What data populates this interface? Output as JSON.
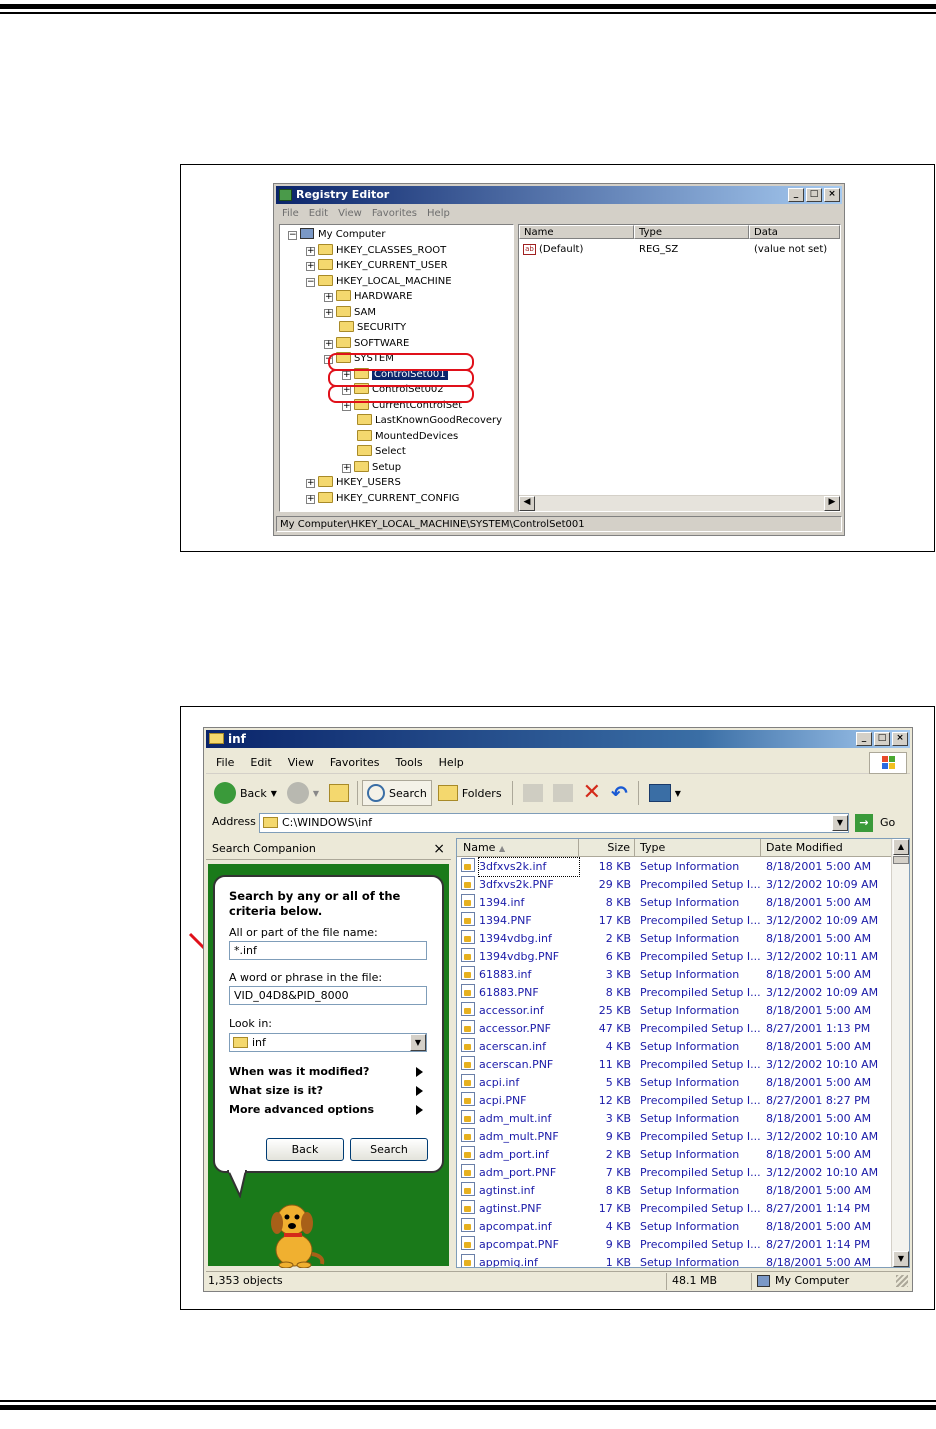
{
  "registry": {
    "title": "Registry Editor",
    "menu": [
      "File",
      "Edit",
      "View",
      "Favorites",
      "Help"
    ],
    "tree": [
      {
        "label": "My Computer",
        "depth": 0,
        "exp": "−",
        "icon": "computer"
      },
      {
        "label": "HKEY_CLASSES_ROOT",
        "depth": 1,
        "exp": "+"
      },
      {
        "label": "HKEY_CURRENT_USER",
        "depth": 1,
        "exp": "+"
      },
      {
        "label": "HKEY_LOCAL_MACHINE",
        "depth": 1,
        "exp": "−"
      },
      {
        "label": "HARDWARE",
        "depth": 2,
        "exp": "+"
      },
      {
        "label": "SAM",
        "depth": 2,
        "exp": "+"
      },
      {
        "label": "SECURITY",
        "depth": 2,
        "exp": ""
      },
      {
        "label": "SOFTWARE",
        "depth": 2,
        "exp": "+"
      },
      {
        "label": "SYSTEM",
        "depth": 2,
        "exp": "−"
      },
      {
        "label": "ControlSet001",
        "depth": 3,
        "exp": "+",
        "selected": true
      },
      {
        "label": "ControlSet002",
        "depth": 3,
        "exp": "+"
      },
      {
        "label": "CurrentControlSet",
        "depth": 3,
        "exp": "+"
      },
      {
        "label": "LastKnownGoodRecovery",
        "depth": 3,
        "exp": ""
      },
      {
        "label": "MountedDevices",
        "depth": 3,
        "exp": ""
      },
      {
        "label": "Select",
        "depth": 3,
        "exp": ""
      },
      {
        "label": "Setup",
        "depth": 3,
        "exp": "+"
      },
      {
        "label": "HKEY_USERS",
        "depth": 1,
        "exp": "+"
      },
      {
        "label": "HKEY_CURRENT_CONFIG",
        "depth": 1,
        "exp": "+"
      }
    ],
    "columns": {
      "name": "Name",
      "type": "Type",
      "data": "Data"
    },
    "row": {
      "name": "(Default)",
      "type": "REG_SZ",
      "data": "(value not set)"
    },
    "status": "My Computer\\HKEY_LOCAL_MACHINE\\SYSTEM\\ControlSet001"
  },
  "explorer": {
    "title": "inf",
    "menu": [
      "File",
      "Edit",
      "View",
      "Favorites",
      "Tools",
      "Help"
    ],
    "toolbar": {
      "back": "Back",
      "search": "Search",
      "folders": "Folders"
    },
    "address_label": "Address",
    "address_value": "C:\\WINDOWS\\inf",
    "go_label": "Go",
    "companion": {
      "header": "Search Companion",
      "close": "×",
      "intro": "Search by any or all of the criteria below.",
      "name_label": "All or part of the file name:",
      "name_value": "*.inf",
      "phrase_label": "A word or phrase in the file:",
      "phrase_value": "VID_04D8&PID_8000",
      "lookin_label": "Look in:",
      "lookin_value": "inf",
      "options": [
        "When was it modified?",
        "What size is it?",
        "More advanced options"
      ],
      "back": "Back",
      "search": "Search"
    },
    "columns": {
      "name": "Name",
      "size": "Size",
      "type": "Type",
      "date": "Date Modified"
    },
    "files": [
      [
        "3dfxvs2k.inf",
        "18 KB",
        "Setup Information",
        "8/18/2001 5:00 AM"
      ],
      [
        "3dfxvs2k.PNF",
        "29 KB",
        "Precompiled Setup I...",
        "3/12/2002 10:09 AM"
      ],
      [
        "1394.inf",
        "8 KB",
        "Setup Information",
        "8/18/2001 5:00 AM"
      ],
      [
        "1394.PNF",
        "17 KB",
        "Precompiled Setup I...",
        "3/12/2002 10:09 AM"
      ],
      [
        "1394vdbg.inf",
        "2 KB",
        "Setup Information",
        "8/18/2001 5:00 AM"
      ],
      [
        "1394vdbg.PNF",
        "6 KB",
        "Precompiled Setup I...",
        "3/12/2002 10:11 AM"
      ],
      [
        "61883.inf",
        "3 KB",
        "Setup Information",
        "8/18/2001 5:00 AM"
      ],
      [
        "61883.PNF",
        "8 KB",
        "Precompiled Setup I...",
        "3/12/2002 10:09 AM"
      ],
      [
        "accessor.inf",
        "25 KB",
        "Setup Information",
        "8/18/2001 5:00 AM"
      ],
      [
        "accessor.PNF",
        "47 KB",
        "Precompiled Setup I...",
        "8/27/2001 1:13 PM"
      ],
      [
        "acerscan.inf",
        "4 KB",
        "Setup Information",
        "8/18/2001 5:00 AM"
      ],
      [
        "acerscan.PNF",
        "11 KB",
        "Precompiled Setup I...",
        "3/12/2002 10:10 AM"
      ],
      [
        "acpi.inf",
        "5 KB",
        "Setup Information",
        "8/18/2001 5:00 AM"
      ],
      [
        "acpi.PNF",
        "12 KB",
        "Precompiled Setup I...",
        "8/27/2001 8:27 PM"
      ],
      [
        "adm_mult.inf",
        "3 KB",
        "Setup Information",
        "8/18/2001 5:00 AM"
      ],
      [
        "adm_mult.PNF",
        "9 KB",
        "Precompiled Setup I...",
        "3/12/2002 10:10 AM"
      ],
      [
        "adm_port.inf",
        "2 KB",
        "Setup Information",
        "8/18/2001 5:00 AM"
      ],
      [
        "adm_port.PNF",
        "7 KB",
        "Precompiled Setup I...",
        "3/12/2002 10:10 AM"
      ],
      [
        "agtinst.inf",
        "8 KB",
        "Setup Information",
        "8/18/2001 5:00 AM"
      ],
      [
        "agtinst.PNF",
        "17 KB",
        "Precompiled Setup I...",
        "8/27/2001 1:14 PM"
      ],
      [
        "apcompat.inf",
        "4 KB",
        "Setup Information",
        "8/18/2001 5:00 AM"
      ],
      [
        "apcompat.PNF",
        "9 KB",
        "Precompiled Setup I...",
        "8/27/2001 1:14 PM"
      ],
      [
        "appmig.inf",
        "1 KB",
        "Setup Information",
        "8/18/2001 5:00 AM"
      ]
    ],
    "status": {
      "count": "1,353 objects",
      "size": "48.1 MB",
      "location": "My Computer"
    }
  }
}
